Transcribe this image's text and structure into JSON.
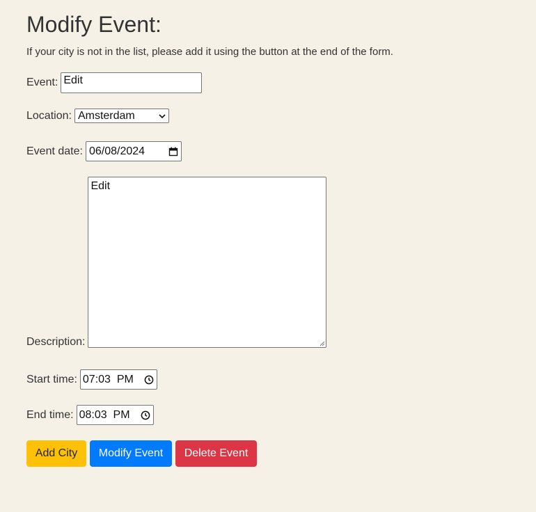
{
  "page": {
    "title": "Modify Event:",
    "intro": "If your city is not in the list, please add it using the button at the end of the form."
  },
  "form": {
    "event": {
      "label": "Event:",
      "value": "Edit"
    },
    "location": {
      "label": "Location:",
      "selected": "Amsterdam"
    },
    "event_date": {
      "label": "Event date:",
      "value": "06/08/2024",
      "icon": "calendar-icon"
    },
    "description": {
      "label": "Description:",
      "value": "Edit"
    },
    "start_time": {
      "label": "Start time:",
      "value": "07:03  PM",
      "icon": "clock-icon"
    },
    "end_time": {
      "label": "End time:",
      "value": "08:03  PM",
      "icon": "clock-icon"
    }
  },
  "buttons": {
    "add_city": "Add City",
    "modify_event": "Modify Event",
    "delete_event": "Delete Event"
  },
  "colors": {
    "background": "#f6f1e7",
    "add_city": "#ffc107",
    "modify_event": "#007bff",
    "delete_event": "#dc3545"
  }
}
